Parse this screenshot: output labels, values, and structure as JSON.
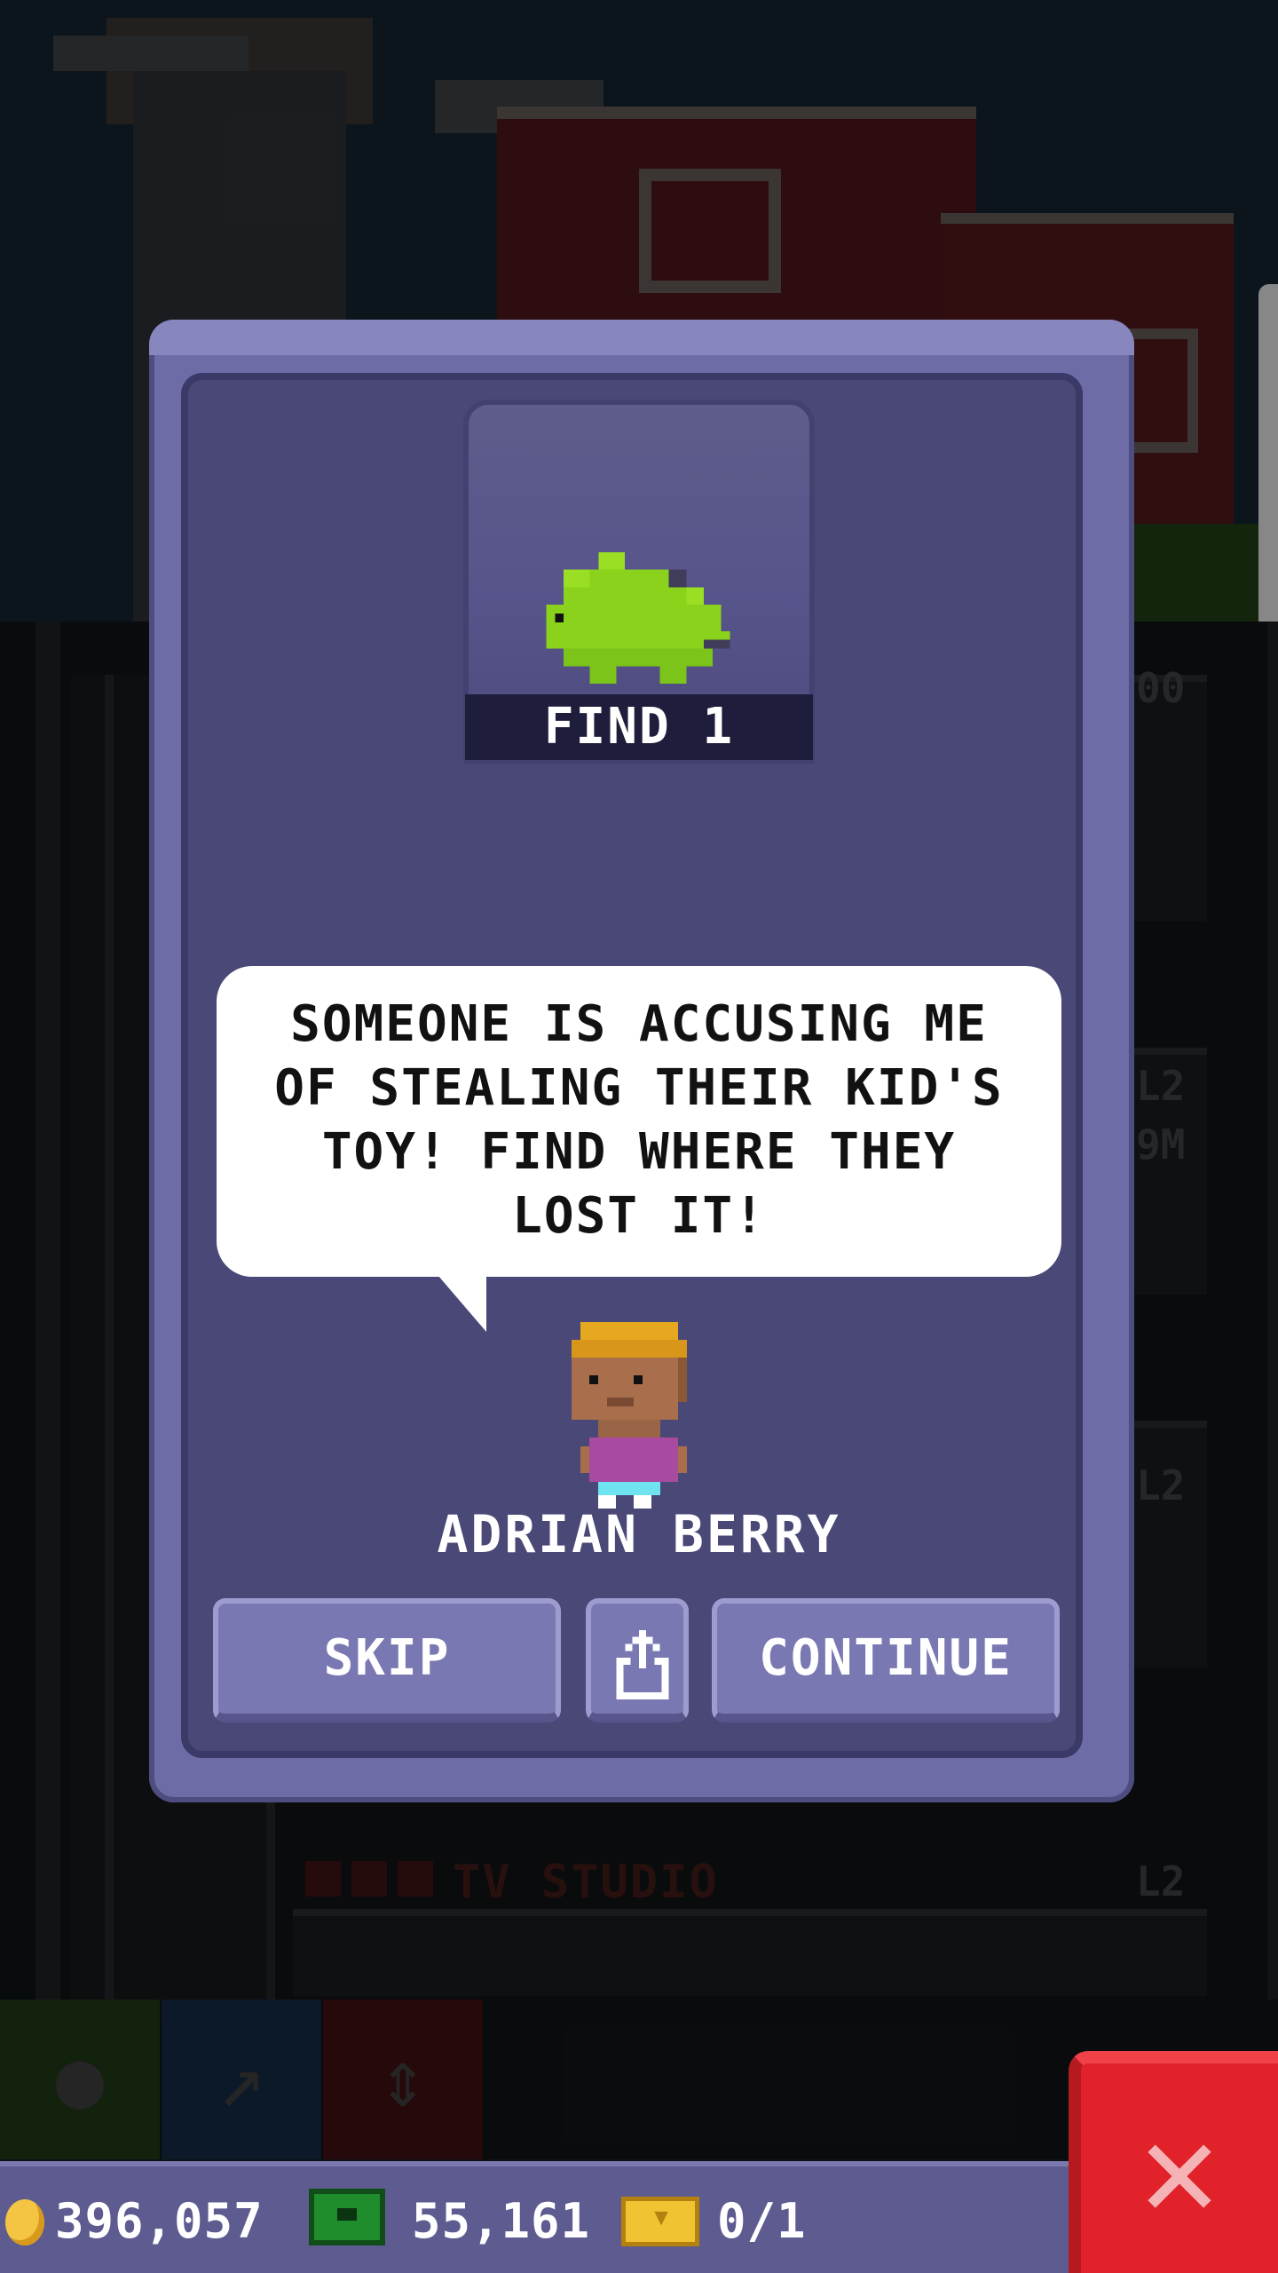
{
  "dialog": {
    "objective": "FIND 1",
    "message": "SOMEONE IS ACCUSING ME OF STEALING THEIR KID'S TOY! FIND WHERE THEY LOST IT!",
    "character_name": "ADRIAN BERRY",
    "skip_label": "SKIP",
    "continue_label": "CONTINUE",
    "share_icon": "share-icon",
    "item_icon": "dinosaur-toy-icon"
  },
  "background": {
    "floor_title": "TV STUDIO",
    "floor_level": "L2",
    "side_labels": [
      "00",
      "L2",
      "9M",
      "L2",
      "L2"
    ]
  },
  "status": {
    "coins": "396,057",
    "bux": "55,161",
    "tickets": "0/1"
  },
  "colors": {
    "dialog_bg": "#4a4876",
    "dialog_frame": "#6e6ca6",
    "button": "#7a78b2",
    "close_button": "#e2222a",
    "status_bar": "#5d5b8f"
  }
}
